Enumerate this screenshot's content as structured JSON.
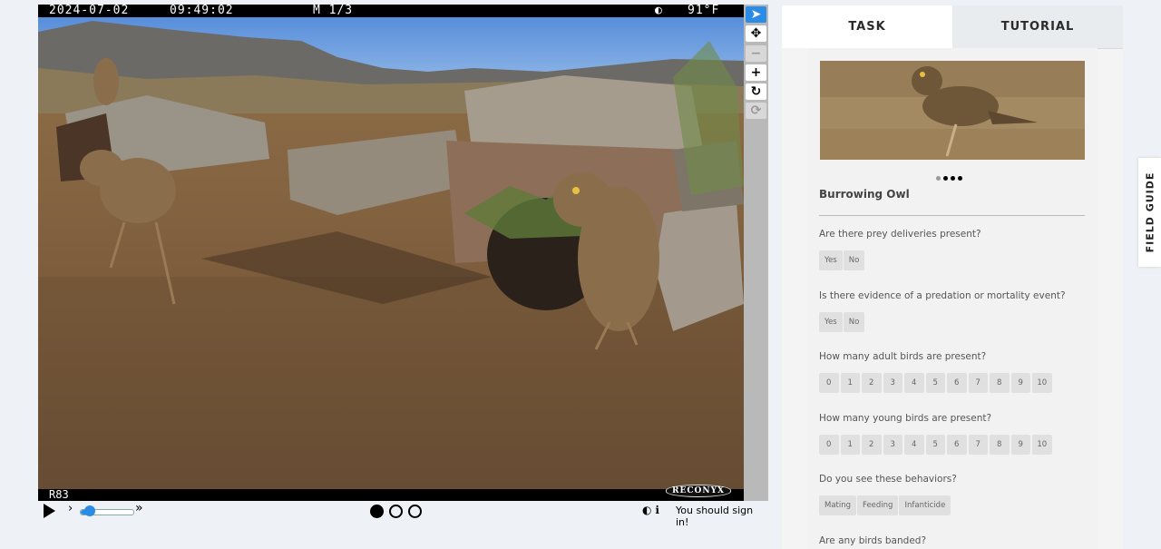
{
  "viewer": {
    "header": {
      "date": "2024-07-02",
      "time": "09:49:02",
      "mode": "M 1/3",
      "moon": "◐",
      "temp": "91°F"
    },
    "footer": {
      "camera_id": "R83",
      "brand": "RECONYX"
    },
    "tools": [
      {
        "name": "pointer-tool",
        "icon": "cursor-icon",
        "glyph": "➤"
      },
      {
        "name": "move-tool",
        "icon": "move-icon",
        "glyph": "✥"
      },
      {
        "name": "zoom-out-tool",
        "icon": "minus-icon",
        "glyph": "−"
      },
      {
        "name": "zoom-in-tool",
        "icon": "plus-icon",
        "glyph": "+"
      },
      {
        "name": "rotate-tool",
        "icon": "rotate-icon",
        "glyph": "↻"
      },
      {
        "name": "reset-tool",
        "icon": "reset-icon",
        "glyph": "⟳"
      }
    ]
  },
  "controls": {
    "play_icon": "play-icon",
    "slow_glyph": "›",
    "fast_glyph": "»",
    "speed_level": 0.15,
    "frames": {
      "total": 3,
      "current": 1
    },
    "sign_in": "You should sign in!",
    "invert_glyph": "◐",
    "info_glyph": "ℹ"
  },
  "task": {
    "tabs": {
      "task": "TASK",
      "tutorial": "TUTORIAL"
    },
    "carousel": {
      "count": 4,
      "active": 1
    },
    "species": "Burrowing Owl",
    "questions": [
      {
        "text": "Are there prey deliveries present?",
        "options": [
          "Yes",
          "No"
        ]
      },
      {
        "text": "Is there evidence of a predation or mortality event?",
        "options": [
          "Yes",
          "No"
        ]
      },
      {
        "text": "How many adult birds are present?",
        "options": [
          "0",
          "1",
          "2",
          "3",
          "4",
          "5",
          "6",
          "7",
          "8",
          "9",
          "10"
        ]
      },
      {
        "text": "How many young birds are present?",
        "options": [
          "0",
          "1",
          "2",
          "3",
          "4",
          "5",
          "6",
          "7",
          "8",
          "9",
          "10"
        ]
      },
      {
        "text": "Do you see these behaviors?",
        "options": [
          "Mating",
          "Feeding",
          "Infanticide"
        ]
      },
      {
        "text": "Are any birds banded?",
        "options": []
      }
    ]
  },
  "field_guide": "FIELD GUIDE",
  "colors": {
    "accent": "#2b8ce6",
    "panel": "#f2f2f2",
    "page": "#eef1f5"
  }
}
